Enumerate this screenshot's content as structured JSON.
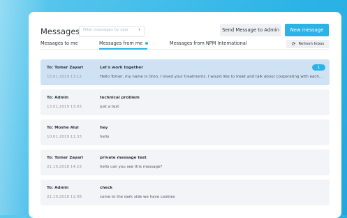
{
  "header": {
    "title": "Messages",
    "filter_placeholder": "Filter messages by user",
    "send_admin_label": "Send Message to Admin",
    "new_message_label": "New message"
  },
  "tabs": [
    {
      "label": "Messages to me",
      "active": false
    },
    {
      "label": "Messages from me",
      "active": true
    },
    {
      "label": "Messages from NPM International",
      "active": false
    }
  ],
  "refresh_label": "Refresh Inbox",
  "icons": {
    "filter_chevron": "chevron-down-icon",
    "refresh": "refresh-icon"
  },
  "colors": {
    "accent": "#2bb3e6",
    "selected_row": "#cfe2f3",
    "row": "#f3f4f7"
  },
  "messages": [
    {
      "to": "To: Tomer Zayari",
      "date": "15.01.2019 13:12",
      "subject": "Let's work together",
      "preview": "Hello Tomer, my name is Oron. I loved your treatments. I would like to meet and talk about cooperating with each...",
      "badge": "1",
      "selected": true
    },
    {
      "to": "To: Admin",
      "date": "13.01.2019 13:03",
      "subject": "technical problem",
      "preview": "just a test"
    },
    {
      "to": "To: Moshe Alul",
      "date": "10.01.2019 11:33",
      "subject": "hey",
      "preview": "hello"
    },
    {
      "to": "To: Tomer Zayari",
      "date": "21.10.2018 14:23",
      "subject": "private message test",
      "preview": "hello can you see this message?"
    },
    {
      "to": "To: Admin",
      "date": "21.10.2018 11:08",
      "subject": "check",
      "preview": "come to the dark side we have cookies"
    }
  ]
}
